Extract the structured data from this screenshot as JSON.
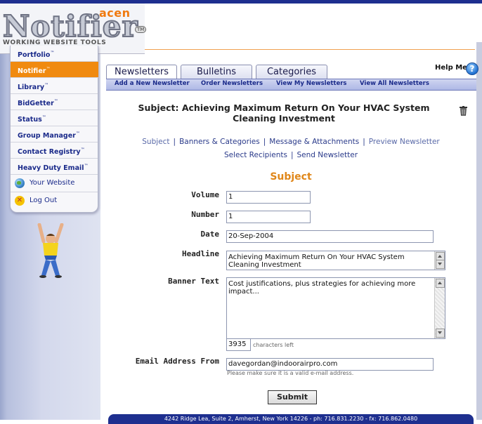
{
  "brand": {
    "company": "acen",
    "product": "Notifier",
    "tm": "TM",
    "tagline": "WORKING WEBSITE TOOLS"
  },
  "sidebar": {
    "items": [
      {
        "label": "Portfolio",
        "tm": "™"
      },
      {
        "label": "Notifier",
        "tm": "™",
        "active": true
      },
      {
        "label": "Library",
        "tm": "™"
      },
      {
        "label": "BidGetter",
        "tm": "™"
      },
      {
        "label": "Status",
        "tm": "™"
      },
      {
        "label": "Group Manager",
        "tm": "™"
      },
      {
        "label": "Contact Registry",
        "tm": "™"
      },
      {
        "label": "Heavy Duty Email",
        "tm": "™"
      }
    ],
    "your_website": "Your Website",
    "log_out": "Log Out"
  },
  "tabs": [
    "Newsletters",
    "Bulletins",
    "Categories"
  ],
  "help_label": "Help Me",
  "help_glyph": "?",
  "subnav": [
    "Add a New Newsletter",
    "Order Newsletters",
    "View My Newsletters",
    "View All Newsletters"
  ],
  "subject_title": "Subject: Achieving Maximum Return On Your HVAC System Cleaning Investment",
  "steps": {
    "line1": [
      "Subject",
      "Banners & Categories",
      "Message & Attachments",
      "Preview Newsletter"
    ],
    "line2": [
      "Select Recipients",
      "Send Newsletter"
    ],
    "separator": "|"
  },
  "section_title": "Subject",
  "form": {
    "volume_label": "Volume",
    "volume_value": "1",
    "number_label": "Number",
    "number_value": "1",
    "date_label": "Date",
    "date_value": "20-Sep-2004",
    "headline_label": "Headline",
    "headline_value": "Achieving Maximum Return On Your HVAC System Cleaning Investment",
    "banner_label": "Banner Text",
    "banner_value": "Cost justifications, plus strategies for achieving more impact...",
    "chars_left_value": "3935",
    "chars_left_text": "characters left",
    "email_label": "Email Address From",
    "email_value": "davegordan@indoorairpro.com",
    "email_hint": "Please make sure it is a valid e-mail address.",
    "submit_label": "Submit"
  },
  "footer_text": "4242 Ridge Lea, Suite 2, Amherst, New York 14226  -  ph: 716.831.2230  -  fx: 716.862.0480",
  "colors": {
    "accent_orange": "#f08a10",
    "nav_blue": "#1a2a8a",
    "top_blue": "#1e2f8f"
  }
}
